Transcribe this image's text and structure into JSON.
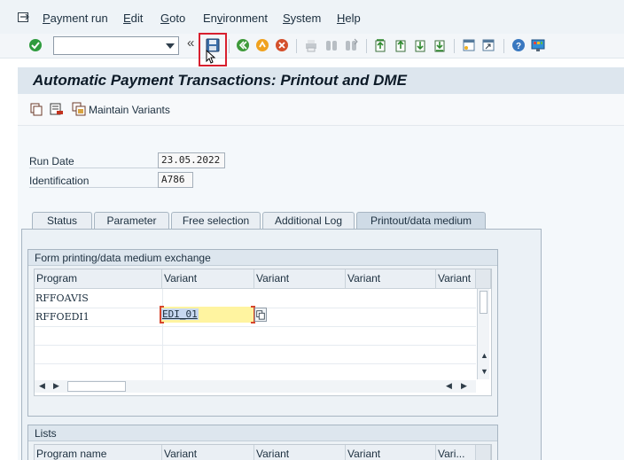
{
  "menu": {
    "items": [
      {
        "pre": "",
        "u": "P",
        "post": "ayment run"
      },
      {
        "pre": "",
        "u": "E",
        "post": "dit"
      },
      {
        "pre": "",
        "u": "G",
        "post": "oto"
      },
      {
        "pre": "En",
        "u": "v",
        "post": "ironment"
      },
      {
        "pre": "",
        "u": "S",
        "post": "ystem"
      },
      {
        "pre": "",
        "u": "H",
        "post": "elp"
      }
    ]
  },
  "toolbar": {
    "command_value": "",
    "chevron": "«",
    "icons": [
      "enter-icon",
      "save-icon",
      "back-icon",
      "exit-icon",
      "cancel-icon",
      "print-icon",
      "find-icon",
      "find-next-icon",
      "first-page-icon",
      "previous-page-icon",
      "next-page-icon",
      "last-page-icon",
      "new-session-icon",
      "shortcut-icon",
      "help-icon",
      "customize-layout-icon"
    ]
  },
  "title": "Automatic Payment Transactions: Printout and DME",
  "app_toolbar": {
    "maintain_variants_label": "Maintain Variants"
  },
  "fields": {
    "run_date_label": "Run Date",
    "run_date_value": "23.05.2022",
    "identification_label": "Identification",
    "identification_value": "A786"
  },
  "tabs": [
    "Status",
    "Parameter",
    "Free selection",
    "Additional Log",
    "Printout/data medium"
  ],
  "active_tab": "Printout/data medium",
  "form_group": {
    "title": "Form printing/data medium exchange",
    "columns": [
      "Program",
      "Variant",
      "Variant",
      "Variant",
      "Variant"
    ],
    "rows": [
      {
        "program": "RFFOAVIS",
        "variant": ""
      },
      {
        "program": "RFFOEDI1",
        "variant": "EDI_01"
      }
    ]
  },
  "lists_group": {
    "title": "Lists",
    "columns": [
      "Program name",
      "Variant",
      "Variant",
      "Variant",
      "Vari..."
    ]
  },
  "colors": {
    "highlight_border": "#d8202f",
    "title_bg": "#dde6ee",
    "edit_field_bg": "#fff4a0"
  }
}
